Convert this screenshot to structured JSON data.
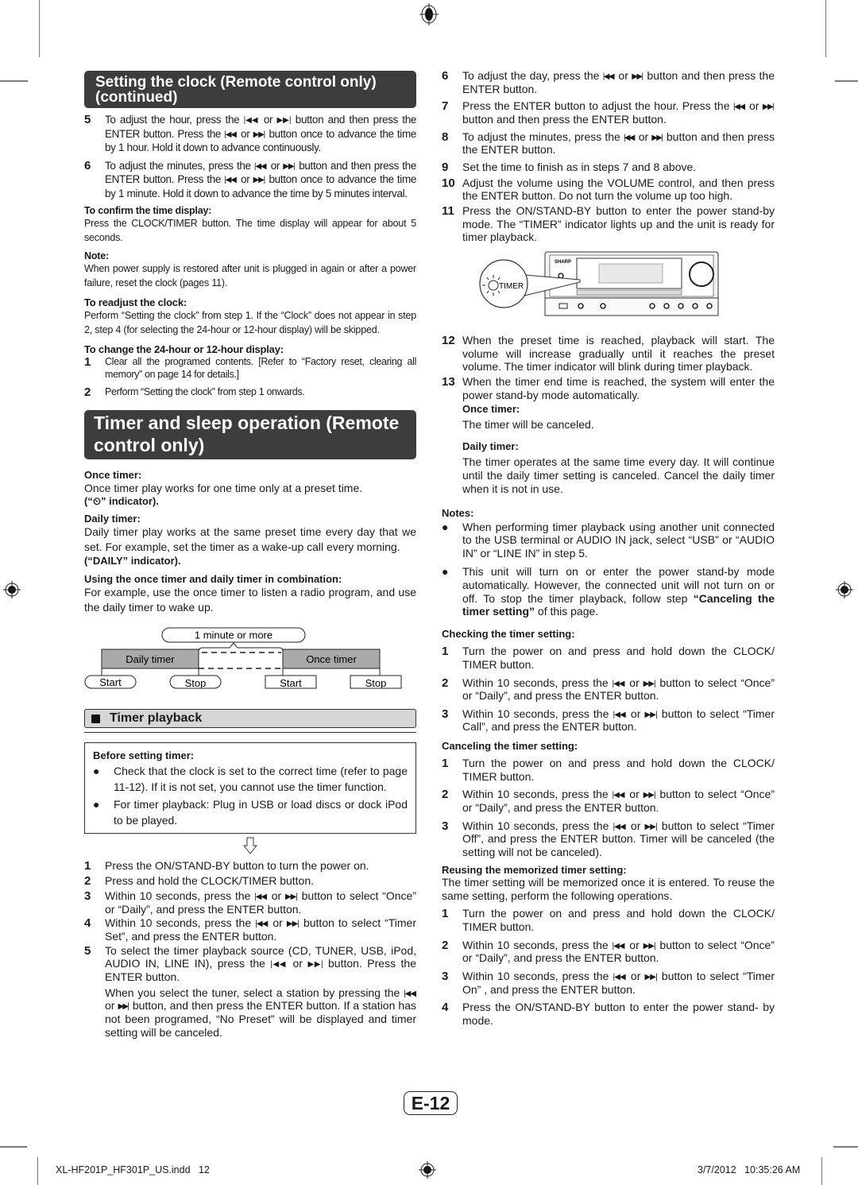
{
  "left": {
    "heading1": "Setting the clock (Remote control only) (continued)",
    "steps_clock": [
      {
        "num": "5",
        "text": "To adjust the hour, press the ◀◀ or ▶▶ button and then press the ENTER button. Press the ◀◀ or ▶▶ button once to advance the time by 1 hour. Hold it down to advance continuously."
      },
      {
        "num": "6",
        "text": "To adjust the minutes, press the ◀◀ or ▶▶ button and then press the ENTER button. Press the ◀◀ or ▶▶ button once to advance the time by 1 minute. Hold it down to advance the time by 5 minutes interval."
      }
    ],
    "confirm_label": "To confirm the time display:",
    "confirm_text": "Press the CLOCK/TIMER button. The time display will appear for about 5 seconds.",
    "note_label": "Note:",
    "note_text": "When power supply is restored after unit is plugged in again or after a power failure, reset the clock (pages 11).",
    "readjust_label": "To readjust the clock:",
    "readjust_text": "Perform “Setting the clock” from step 1. If the “Clock” does not appear in step 2, step 4 (for selecting the 24-hour or 12-hour display) will be skipped.",
    "change_label": "To change the 24-hour or 12-hour display:",
    "change_steps": [
      {
        "num": "1",
        "text": "Clear all the programed contents. [Refer to “Factory reset, clearing all memory” on page 14 for details.]"
      },
      {
        "num": "2",
        "text": "Perform “Setting the clock” from step 1 onwards."
      }
    ],
    "heading2": "Timer and sleep operation (Remote control only)",
    "once_label": "Once timer:",
    "once_text": "Once timer play works for one time only at a preset time.",
    "once_indicator": "(“⏲” indicator).",
    "daily_label": "Daily timer:",
    "daily_text": "Daily timer play works at the same preset time every day that we set. For example, set the timer as a wake-up call every morning.",
    "daily_indicator": "(“DAILY” indicator).",
    "combo_label": "Using the once timer and daily timer in combination:",
    "combo_text": "For example, use the once timer to listen a radio program, and use the daily timer to wake up.",
    "diagram": {
      "gap_label": "1 minute or more",
      "daily_label": "Daily timer",
      "once_label": "Once timer",
      "daily_start": "Start",
      "daily_stop": "Stop",
      "once_start": "Start",
      "once_stop": "Stop"
    },
    "subheading": "Timer playback",
    "before_label": "Before setting timer:",
    "before_bullets": [
      "Check that the clock is set to the correct time (refer to page 11-12). If it is not set, you cannot use the timer function.",
      "For timer playback: Plug in USB or load discs or dock iPod to be played."
    ],
    "playback_steps": [
      {
        "num": "1",
        "text": "Press the ON/STAND-BY button to turn the power on."
      },
      {
        "num": "2",
        "text": "Press and hold the CLOCK/TIMER button."
      },
      {
        "num": "3",
        "text": "Within 10 seconds, press the ◀◀ or ▶▶ button to select “Once” or “Daily”, and press the ENTER button."
      },
      {
        "num": "4",
        "text": "Within 10 seconds, press the ◀◀ or ▶▶ button to select “Timer Set”, and press the ENTER button."
      },
      {
        "num": "5",
        "text": "To select the timer playback source (CD, TUNER, USB, iPod, AUDIO IN, LINE IN), press the ◀◀ or ▶▶ button. Press the ENTER button."
      }
    ],
    "tuner_note": "When you select the tuner, select a station by pressing the ◀◀ or ▶▶ button, and then press the ENTER button. If a station has not been programed, “No Preset” will be displayed and timer setting will be canceled."
  },
  "right": {
    "steps_a": [
      {
        "num": "6",
        "text": "To adjust the day, press the ◀◀ or ▶▶ button and then press the ENTER button."
      },
      {
        "num": "7",
        "text": "Press the ENTER button to adjust the hour. Press the ◀◀ or ▶▶ button and then press the ENTER button."
      },
      {
        "num": "8",
        "text": "To adjust the minutes, press the ◀◀ or ▶▶ button and then press the ENTER button."
      },
      {
        "num": "9",
        "text": "Set the time to finish as in steps 7 and 8 above."
      },
      {
        "num": "10",
        "text": "Adjust the volume using the VOLUME control, and then press the ENTER button. Do not turn the volume up too high."
      },
      {
        "num": "11",
        "text": "Press the ON/STAND-BY button to enter the power stand-by mode. The “TIMER” indicator lights up and the unit is ready for timer playback."
      }
    ],
    "device": {
      "brand": "SHARP",
      "indicator_label": "TIMER"
    },
    "steps_b": [
      {
        "num": "12",
        "text": "When the preset time is reached, playback will start. The volume will increase gradually until it reaches the preset volume. The timer indicator will blink during timer playback."
      },
      {
        "num": "13",
        "text": "When the timer end time is reached, the system will enter the power stand-by mode automatically."
      }
    ],
    "once_label": "Once timer:",
    "once_text": "The timer will be canceled.",
    "daily_label": "Daily timer:",
    "daily_text": "The timer operates at the same time every day. It will continue until the daily timer setting is canceled. Cancel the daily timer when it is not in use.",
    "notes_label": "Notes:",
    "notes": [
      "When performing timer playback using another unit connected to the USB terminal or AUDIO IN jack, select “USB” or “AUDIO IN” or “LINE IN” in step 5.",
      "This unit will turn on or enter the power stand-by mode automatically. However, the connected unit will not turn on or off. To stop the timer playback, follow step “Canceling the timer setting” of this page."
    ],
    "checking_label": "Checking the timer setting:",
    "checking_steps": [
      {
        "num": "1",
        "text": "Turn the power on and press and hold down the CLOCK/ TIMER button."
      },
      {
        "num": "2",
        "text": "Within 10 seconds, press the ◀◀ or ▶▶ button to select “Once” or “Daily”, and press the ENTER button."
      },
      {
        "num": "3",
        "text": "Within 10 seconds, press the ◀◀ or ▶▶ button to select “Timer Call”, and press the ENTER button."
      }
    ],
    "canceling_label": "Canceling the timer setting:",
    "canceling_steps": [
      {
        "num": "1",
        "text": "Turn the power on and press and hold down the CLOCK/ TIMER button."
      },
      {
        "num": "2",
        "text": "Within 10 seconds, press the ◀◀ or ▶▶ button to select “Once” or “Daily”, and press the ENTER button."
      },
      {
        "num": "3",
        "text": "Within 10 seconds, press the ◀◀ or ▶▶ button to select “Timer Off”, and press the ENTER button. Timer will be canceled (the setting will not be canceled)."
      }
    ],
    "reusing_label": "Reusing the memorized timer setting:",
    "reusing_text": "The timer setting will be memorized once it is entered. To reuse the same setting, perform the following operations.",
    "reusing_steps": [
      {
        "num": "1",
        "text": "Turn the power on and press and hold down the CLOCK/ TIMER button."
      },
      {
        "num": "2",
        "text": "Within 10 seconds, press the ◀◀ or ▶▶ button to select “Once” or “Daily”, and press the ENTER button."
      },
      {
        "num": "3",
        "text": "Within 10 seconds, press the ◀◀ or ▶▶ button to select “Timer On” , and press the ENTER button."
      },
      {
        "num": "4",
        "text": "Press the ON/STAND-BY button to enter the power stand- by mode."
      }
    ]
  },
  "page_number": "E-12",
  "footer": {
    "file": "XL-HF201P_HF301P_US.indd   12",
    "timestamp": "3/7/2012   10:35:26 AM"
  }
}
